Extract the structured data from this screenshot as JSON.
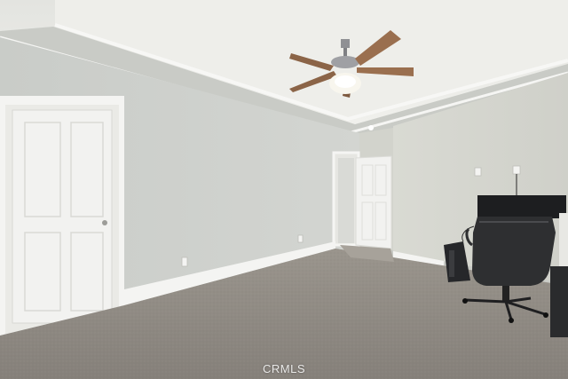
{
  "photo": {
    "watermark": "CRMLS"
  },
  "colors": {
    "ceiling": "#e9eae6",
    "wall_left": "#cdd0cc",
    "wall_right": "#d5d6cf",
    "trim": "#f4f4f2",
    "door": "#f2f2f0",
    "carpet": "#8f8a82",
    "fan_blade": "#9a6f4f",
    "chair": "#2e2f31",
    "monitor": "#1d1e20"
  }
}
